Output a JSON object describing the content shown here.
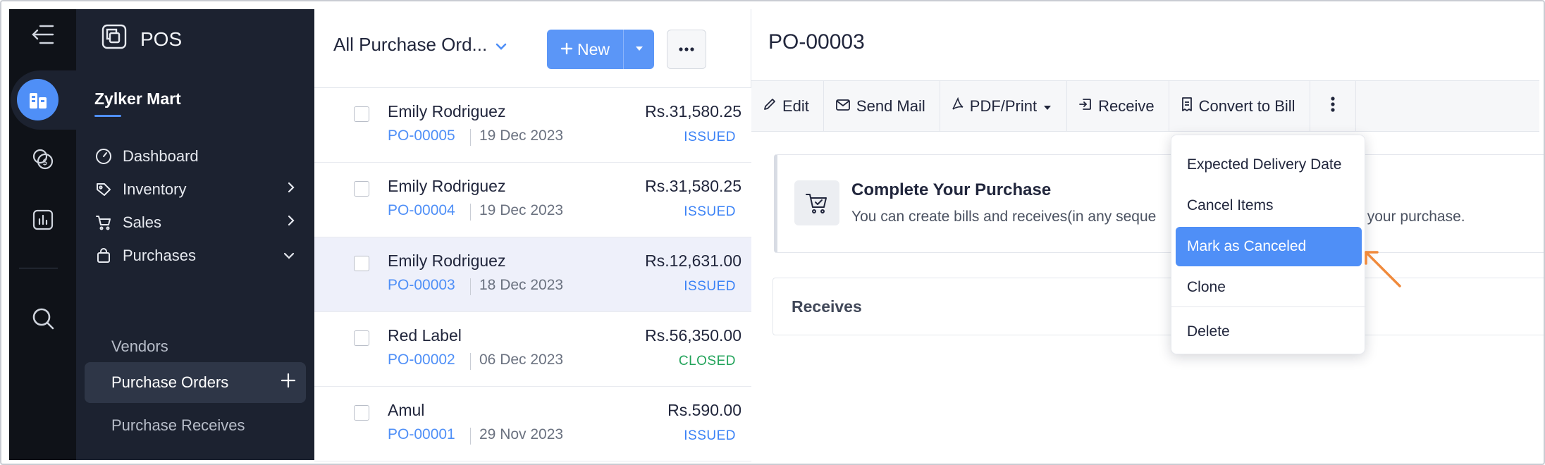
{
  "app": {
    "name": "POS",
    "org_name": "Zylker Mart"
  },
  "sidebar": {
    "nav": [
      {
        "label": "Dashboard",
        "icon": "dashboard-icon"
      },
      {
        "label": "Inventory",
        "icon": "inventory-icon",
        "expandable": true
      },
      {
        "label": "Sales",
        "icon": "cart-icon",
        "expandable": true
      },
      {
        "label": "Purchases",
        "icon": "bag-icon",
        "expanded": true
      }
    ],
    "purchases_sub": [
      {
        "label": "Vendors"
      },
      {
        "label": "Purchase Orders",
        "active": true
      },
      {
        "label": "Purchase Receives"
      }
    ]
  },
  "list": {
    "title": "All Purchase Ord...",
    "new_label": "New",
    "rows": [
      {
        "name": "Emily Rodriguez",
        "po": "PO-00005",
        "date": "19 Dec 2023",
        "amount": "Rs.31,580.25",
        "status": "ISSUED"
      },
      {
        "name": "Emily Rodriguez",
        "po": "PO-00004",
        "date": "19 Dec 2023",
        "amount": "Rs.31,580.25",
        "status": "ISSUED"
      },
      {
        "name": "Emily Rodriguez",
        "po": "PO-00003",
        "date": "18 Dec 2023",
        "amount": "Rs.12,631.00",
        "status": "ISSUED",
        "selected": true
      },
      {
        "name": "Red Label",
        "po": "PO-00002",
        "date": "06 Dec 2023",
        "amount": "Rs.56,350.00",
        "status": "CLOSED"
      },
      {
        "name": "Amul",
        "po": "PO-00001",
        "date": "29 Nov 2023",
        "amount": "Rs.590.00",
        "status": "ISSUED"
      }
    ]
  },
  "detail": {
    "title": "PO-00003",
    "toolbar": {
      "edit": "Edit",
      "send_mail": "Send Mail",
      "pdf_print": "PDF/Print",
      "receive": "Receive",
      "convert_to_bill": "Convert to Bill"
    },
    "card": {
      "title": "Complete Your Purchase",
      "description": "You can create bills and receives(in any seque",
      "description_tail": "plete your purchase."
    },
    "receives_title": "Receives"
  },
  "menu": {
    "items": [
      {
        "label": "Expected Delivery Date"
      },
      {
        "label": "Cancel Items"
      },
      {
        "label": "Mark as Canceled",
        "highlighted": true
      },
      {
        "label": "Clone"
      },
      {
        "label": "Delete"
      }
    ]
  },
  "colors": {
    "accent": "#4f8ff7",
    "status_issued": "#3b82f6",
    "status_closed": "#22a35a",
    "annotation_arrow": "#f08a3c"
  }
}
